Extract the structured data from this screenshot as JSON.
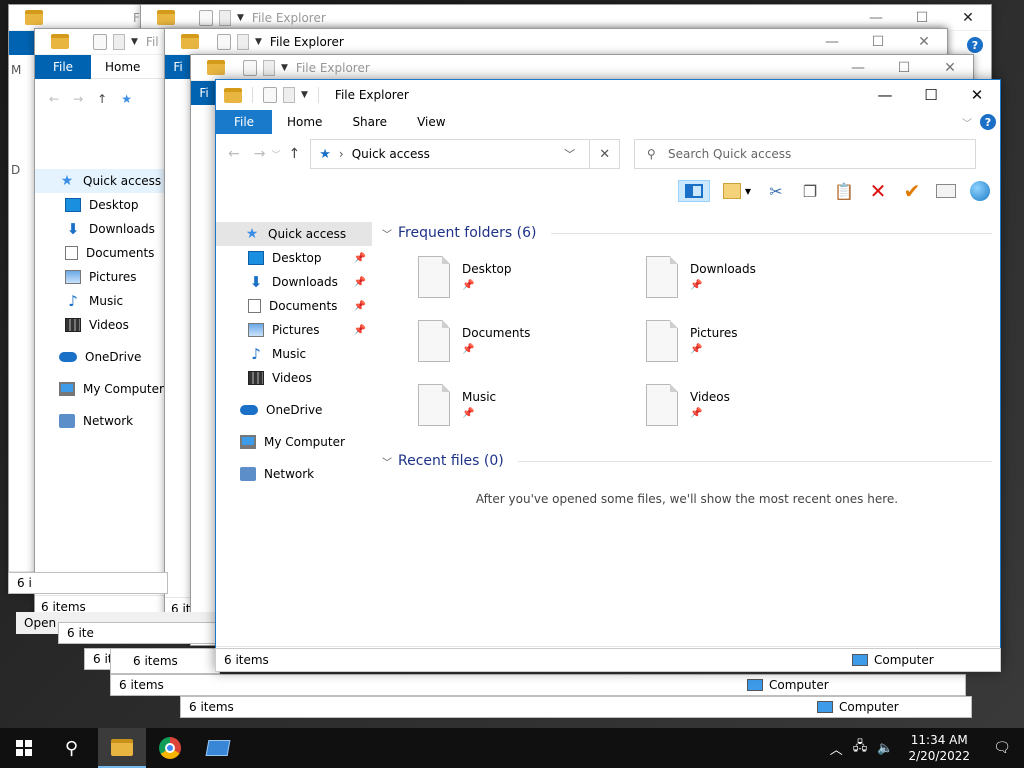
{
  "window": {
    "title": "File Explorer",
    "controls": {
      "minimize": "—",
      "maximize": "☐",
      "close": "✕"
    }
  },
  "ribbon": {
    "file": "File",
    "tabs": [
      "Home",
      "Share",
      "View"
    ]
  },
  "address": {
    "location": "Quick access",
    "search_placeholder": "Search Quick access"
  },
  "nav": {
    "quick_access": "Quick access",
    "pinned": [
      "Desktop",
      "Downloads",
      "Documents",
      "Pictures"
    ],
    "unpinned": [
      "Music",
      "Videos"
    ],
    "onedrive": "OneDrive",
    "computer": "My Computer",
    "network": "Network"
  },
  "content": {
    "frequent_header": "Frequent folders (6)",
    "folders": [
      "Desktop",
      "Downloads",
      "Documents",
      "Pictures",
      "Music",
      "Videos"
    ],
    "recent_header": "Recent files (0)",
    "recent_empty": "After you've opened some files, we'll show the most recent ones here."
  },
  "status": {
    "items": "6 items",
    "computer": "Computer"
  },
  "background": {
    "title": "File Explorer",
    "file": "File",
    "home": "Home",
    "nav": [
      "Quick access",
      "Desktop",
      "Downloads",
      "Documents",
      "Pictures",
      "Music",
      "Videos",
      "OneDrive",
      "My Computer",
      "Network"
    ],
    "items": "6 items",
    "computer": "Computer",
    "fragments": {
      "file_cut": "Fil",
      "file_cut2": "Fi",
      "items_cut": "6 ite",
      "items_cut2": "6 i",
      "open_cut": "Open",
      "letter_m": "M",
      "letter_d": "D"
    }
  },
  "taskbar": {
    "time": "11:34 AM",
    "date": "2/20/2022"
  }
}
